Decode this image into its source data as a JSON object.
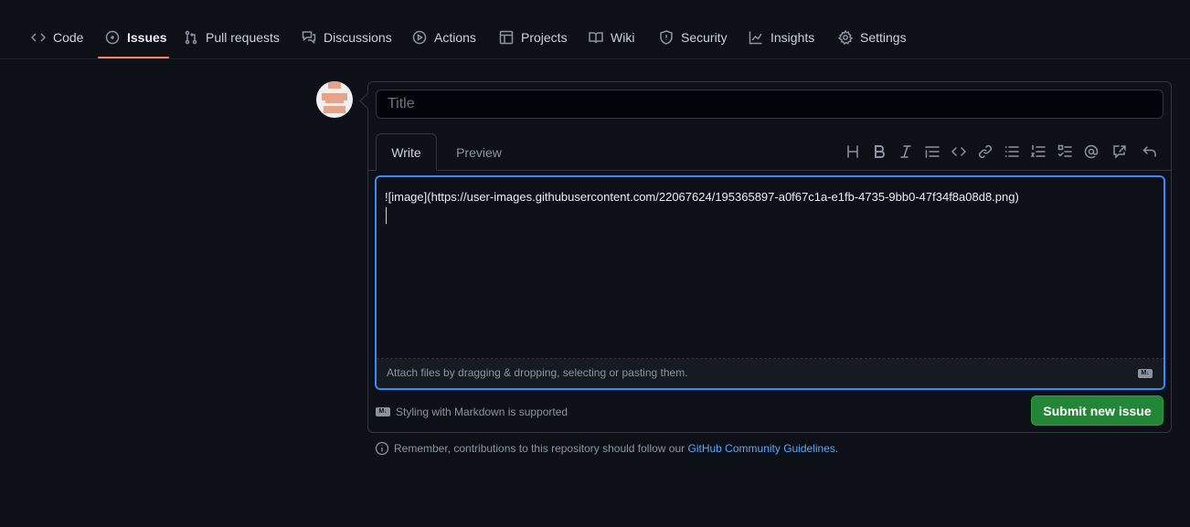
{
  "nav": {
    "items": [
      {
        "label": "Code",
        "icon": "code-icon"
      },
      {
        "label": "Issues",
        "icon": "issue-icon",
        "active": true
      },
      {
        "label": "Pull requests",
        "icon": "pull-request-icon"
      },
      {
        "label": "Discussions",
        "icon": "discussions-icon"
      },
      {
        "label": "Actions",
        "icon": "play-icon"
      },
      {
        "label": "Projects",
        "icon": "table-icon"
      },
      {
        "label": "Wiki",
        "icon": "book-icon"
      },
      {
        "label": "Security",
        "icon": "shield-icon"
      },
      {
        "label": "Insights",
        "icon": "graph-icon"
      },
      {
        "label": "Settings",
        "icon": "gear-icon"
      }
    ]
  },
  "form": {
    "title_placeholder": "Title",
    "title_value": "",
    "tabs": {
      "write": "Write",
      "preview": "Preview"
    },
    "toolbar": [
      "heading",
      "bold",
      "italic",
      "quote",
      "code",
      "link",
      "unordered-list",
      "ordered-list",
      "task-list",
      "mention",
      "cross-reference",
      "undo"
    ],
    "body_value": "![image](https://user-images.githubusercontent.com/22067624/195365897-a0f67c1a-e1fb-4735-9bb0-47f34f8a08d8.png)\n",
    "attach_hint": "Attach files by dragging & dropping, selecting or pasting them.",
    "markdown_note": "Styling with Markdown is supported",
    "submit_label": "Submit new issue"
  },
  "footer": {
    "remember_text": "Remember, contributions to this repository should follow our",
    "link_text": "GitHub Community Guidelines",
    "period": "."
  },
  "colors": {
    "accent": "#388bfd",
    "link": "#58a6ff",
    "submit": "#238636",
    "active_tab_underline": "#f78166",
    "background": "#0d1117"
  }
}
